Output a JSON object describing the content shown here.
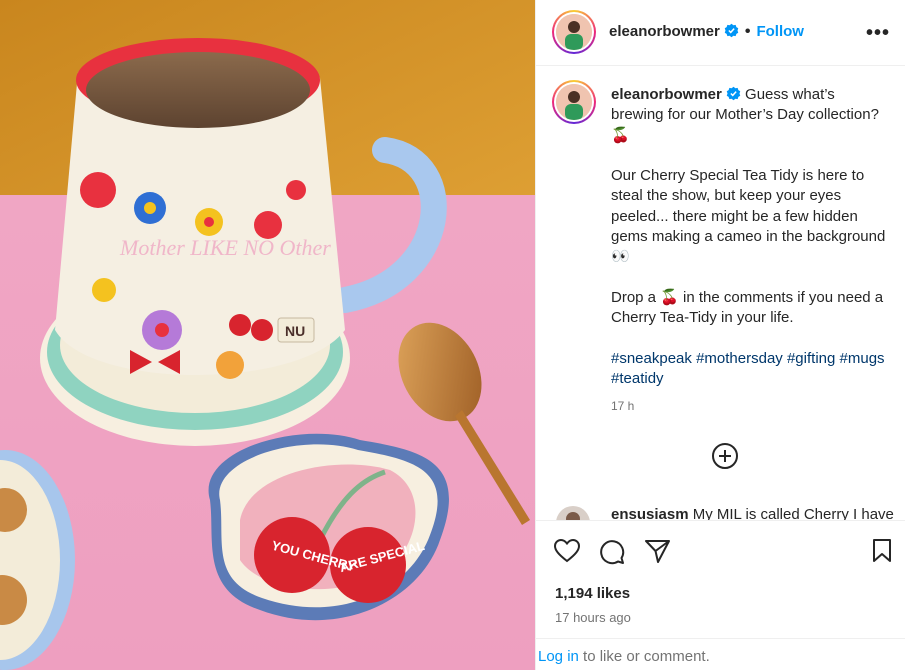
{
  "post": {
    "image_alt": "Mother Like No Other mug with tea and cherry tea-tidy on pink table",
    "mug_text": "Mother LIKE NO Other",
    "dish_left": "YOU CHERRY",
    "dish_right": "ARE SPECIAL"
  },
  "header": {
    "username": "eleanorbowmer",
    "separator": "•",
    "follow_label": "Follow",
    "more_label": "•••"
  },
  "caption": {
    "username": "eleanorbowmer",
    "line1": " Guess what’s brewing for our Mother’s Day collection? 🍒",
    "para2": "Our Cherry Special Tea Tidy is here to steal the show, but keep your eyes peeled... there might be a few hidden gems making a cameo in the background 👀",
    "para3": "Drop a 🍒 in the comments if you need a Cherry Tea-Tidy in your life.",
    "hashtags": [
      "#sneakpeak",
      "#mothersday",
      "#gifting",
      "#mugs",
      "#teatidy"
    ],
    "time": "17 h"
  },
  "comment": {
    "username": "ensusiasm",
    "text": " My MIL is called Cherry I have"
  },
  "actions": {
    "likes": "1,194 likes",
    "posted": "17 hours ago"
  },
  "login": {
    "link": "Log in",
    "rest": " to like or comment."
  },
  "colors": {
    "accent": "#0095f6",
    "hashtag": "#00376b",
    "verified": "#0095f6"
  }
}
